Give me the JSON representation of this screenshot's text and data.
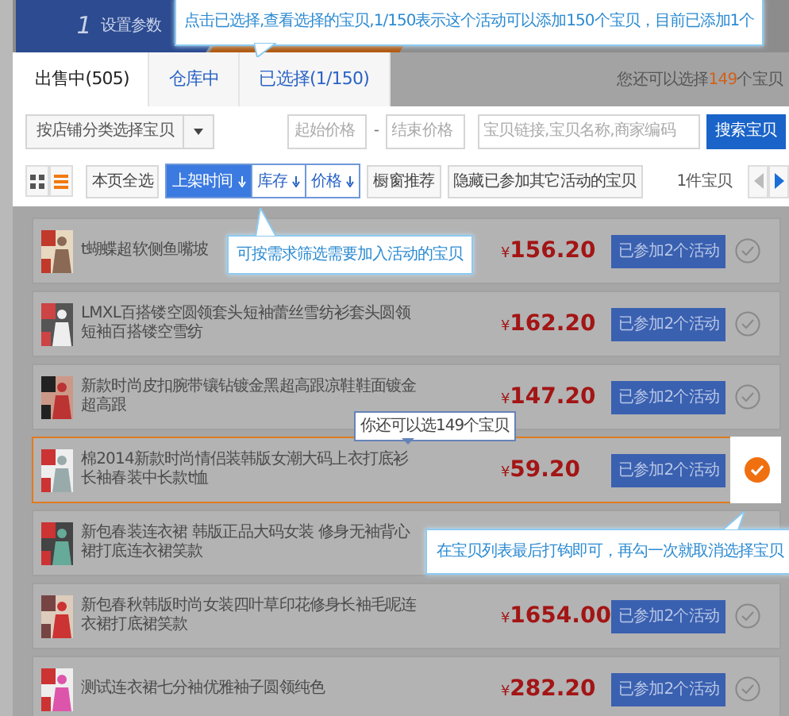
{
  "steps": [
    {
      "number": "1",
      "label": "设置参数",
      "selected": false
    },
    {
      "selected": true
    }
  ],
  "tabs": [
    {
      "label": "出售中(505)",
      "selected": true
    },
    {
      "label": "仓库中",
      "selected": false
    },
    {
      "label": "已选择(1/150)",
      "selected": false
    }
  ],
  "remaining": {
    "prefix": "您还可以选择",
    "count": "149",
    "suffix": "个宝贝"
  },
  "filter": {
    "category": "按店铺分类选择宝贝",
    "min_price_placeholder": "起始价格",
    "separator": "-",
    "max_price_placeholder": "结束价格",
    "keyword_placeholder": "宝贝链接,宝贝名称,商家编码",
    "search_button": "搜索宝贝"
  },
  "toolbar": {
    "view_modes": [
      {
        "kind": "grid",
        "selected": false
      },
      {
        "kind": "list",
        "selected": true
      }
    ],
    "select_all": "本页全选",
    "sorts": [
      {
        "label": "上架时间",
        "selected": true
      },
      {
        "label": "库存",
        "selected": false
      },
      {
        "label": "价格",
        "selected": false
      }
    ],
    "buttons": [
      "橱窗推荐",
      "隐藏已参加其它活动的宝贝"
    ],
    "count": "1件宝贝",
    "pager": [
      {
        "kind": "prev",
        "disabled": true
      },
      {
        "kind": "next",
        "disabled": false
      }
    ]
  },
  "products": [
    {
      "title": "t蝴蝶超软侧鱼嘴坡",
      "currency": "¥",
      "price": "156.20",
      "badge": "已参加2个活动",
      "checked": false
    },
    {
      "title": "LMXL百搭镂空圆领套头短袖蕾丝雪纺衫套头圆领短袖百搭镂空雪纺",
      "currency": "¥",
      "price": "162.20",
      "badge": "已参加2个活动",
      "checked": false
    },
    {
      "title": "新款时尚皮扣腕带镶钻镀金黑超高跟凉鞋鞋面镀金超高跟",
      "currency": "¥",
      "price": "147.20",
      "badge": "已参加2个活动",
      "checked": false
    },
    {
      "title": "棉2014新款时尚情侣装韩版女潮大码上衣打底衫长袖春装中长款t恤",
      "currency": "¥",
      "price": "59.20",
      "badge": "已参加2个活动",
      "checked": true
    },
    {
      "title": "新包春装连衣裙 韩版正品大码女装 修身无袖背心裙打底连衣裙笑款"
    },
    {
      "title": "新包春秋韩版时尚女装四叶草印花修身长袖毛呢连衣裙打底裙笑款",
      "currency": "¥",
      "price": "1654.00",
      "badge": "已参加2个活动",
      "checked": false
    },
    {
      "title": "测试连衣裙七分袖优雅袖子圆领纯色",
      "currency": "¥",
      "price": "282.20",
      "badge": "已参加2个活动",
      "checked": false
    }
  ],
  "guide_tips": [
    {
      "kind": "top",
      "text": "点击已选择,查看选择的宝贝,1/150表示这个活动可以添加150个宝贝，目前已添加1个"
    },
    {
      "kind": "filter",
      "text": "可按需求筛选需要加入活动的宝贝"
    },
    {
      "kind": "count",
      "text": "你还可以选149个宝贝"
    },
    {
      "kind": "check",
      "text": "在宝贝列表最后打钩即可，再勾一次就取消选择宝贝"
    }
  ]
}
